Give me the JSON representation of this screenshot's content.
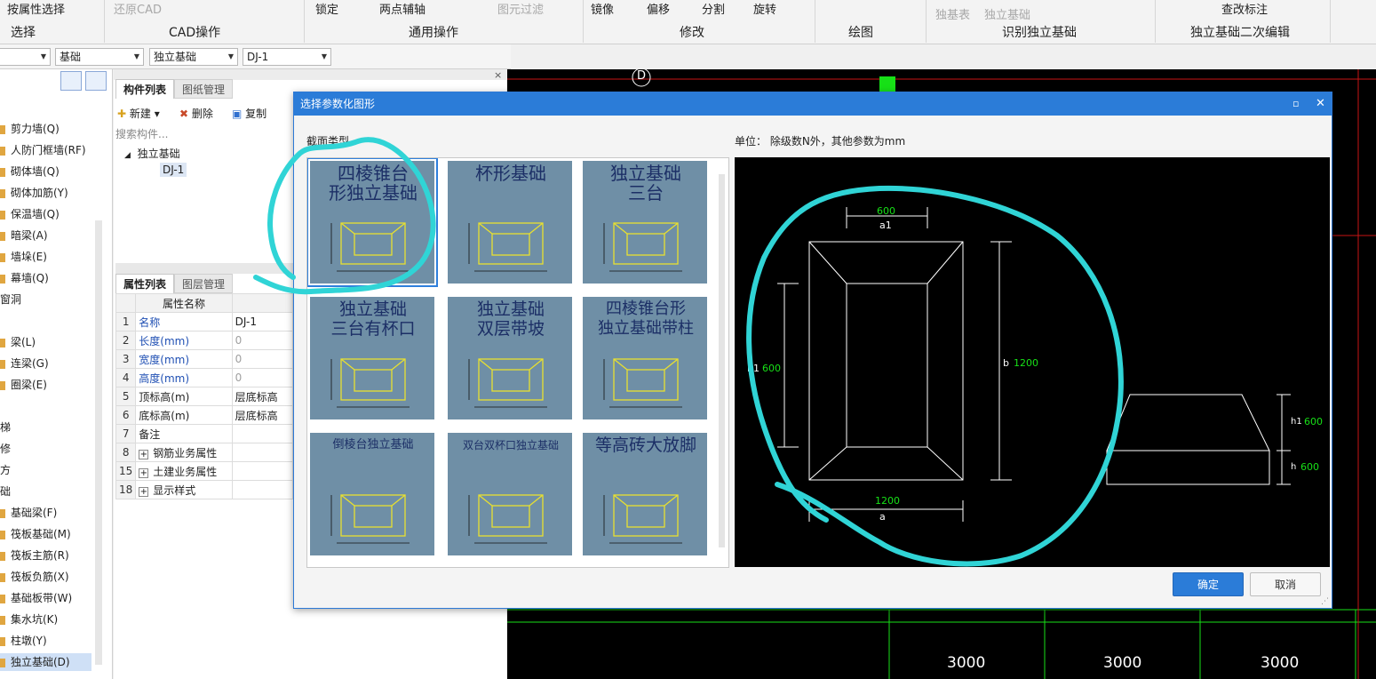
{
  "ribbon": {
    "row1": [
      "按属性选择",
      "还原CAD",
      "锁定",
      "两点辅轴",
      "图元过滤",
      "镜像",
      "偏移",
      "分割",
      "旋转",
      "独基表",
      "独立基础",
      "查改标注"
    ],
    "groups": [
      "选择",
      "CAD操作",
      "通用操作",
      "修改",
      "绘图",
      "识别独立基础",
      "独立基础二次编辑"
    ]
  },
  "combos": [
    "",
    "基础",
    "独立基础",
    "DJ-1"
  ],
  "leftnav": [
    "剪力墙(Q)",
    "人防门框墙(RF)",
    "砌体墙(Q)",
    "砌体加筋(Y)",
    "保温墙(Q)",
    "暗梁(A)",
    "墙垛(E)",
    "幕墙(Q)",
    "窗洞",
    "梁(L)",
    "连梁(G)",
    "圈梁(E)",
    "梯",
    "修",
    "方",
    "础",
    "基础梁(F)",
    "筏板基础(M)",
    "筏板主筋(R)",
    "筏板负筋(X)",
    "基础板带(W)",
    "集水坑(K)",
    "柱墩(Y)",
    "独立基础(D)"
  ],
  "component": {
    "tabs": [
      "构件列表",
      "图纸管理"
    ],
    "toolbar": [
      "新建",
      "删除",
      "复制"
    ],
    "search_placeholder": "搜索构件...",
    "tree_parent": "独立基础",
    "tree_child": "DJ-1"
  },
  "props": {
    "tabs": [
      "属性列表",
      "图层管理"
    ],
    "header": "属性名称",
    "rows": [
      {
        "n": "1",
        "name": "名称",
        "val": "DJ-1",
        "blue": true
      },
      {
        "n": "2",
        "name": "长度(mm)",
        "val": "0",
        "blue": true
      },
      {
        "n": "3",
        "name": "宽度(mm)",
        "val": "0",
        "blue": true
      },
      {
        "n": "4",
        "name": "高度(mm)",
        "val": "0",
        "blue": true
      },
      {
        "n": "5",
        "name": "顶标高(m)",
        "val": "层底标高",
        "blue": false
      },
      {
        "n": "6",
        "name": "底标高(m)",
        "val": "层底标高",
        "blue": false
      },
      {
        "n": "7",
        "name": "备注",
        "val": "",
        "blue": false
      },
      {
        "n": "8",
        "name": "钢筋业务属性",
        "val": "",
        "blue": false,
        "group": true
      },
      {
        "n": "15",
        "name": "土建业务属性",
        "val": "",
        "blue": false,
        "group": true
      },
      {
        "n": "18",
        "name": "显示样式",
        "val": "",
        "blue": false,
        "group": true
      }
    ]
  },
  "cad": {
    "axis_label": "D",
    "dims": [
      "3000",
      "3000",
      "3000"
    ]
  },
  "dialog": {
    "title": "选择参数化图形",
    "section_label": "截面类型",
    "unit_label": "单位： 除级数N外，其他参数为mm",
    "thumbs": [
      {
        "t1": "四棱锥台",
        "t2": "形独立基础"
      },
      {
        "t1": "杯形基础",
        "t2": ""
      },
      {
        "t1": "独立基础",
        "t2": "三台"
      },
      {
        "t1": "独立基础",
        "t2": "三台有杯口"
      },
      {
        "t1": "独立基础",
        "t2": "双层带坡"
      },
      {
        "t1": "四棱锥台形",
        "t2": "独立基础带柱"
      },
      {
        "t1": "倒棱台独立基础",
        "t2": ""
      },
      {
        "t1": "双台双杯口独立基础",
        "t2": ""
      },
      {
        "t1": "等高砖大放脚",
        "t2": ""
      }
    ],
    "preview": {
      "a1": "600",
      "a1_name": "a1",
      "b1": "600",
      "b1_name": "b1",
      "b": "1200",
      "b_name": "b",
      "a": "1200",
      "a_name": "a",
      "h1": "600",
      "h1_name": "h1",
      "h": "600",
      "h_name": "h"
    },
    "ok": "确定",
    "cancel": "取消"
  },
  "colors": {
    "annotation": "#30d4d6",
    "accent": "#2b7cd8",
    "cad_green": "#17e017",
    "cad_red": "#c81414"
  }
}
